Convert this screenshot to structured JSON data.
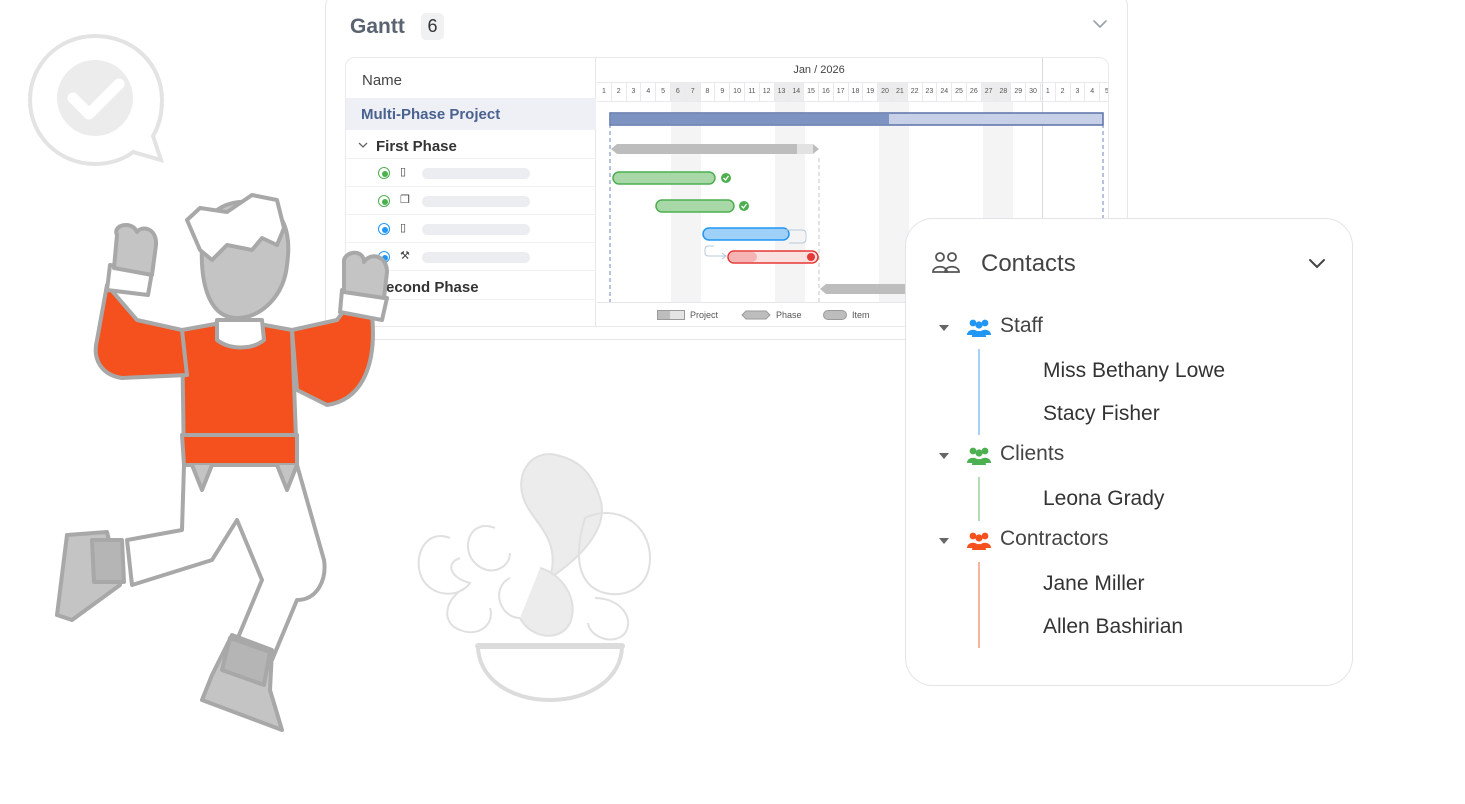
{
  "gantt": {
    "title": "Gantt",
    "count": "6",
    "name_header": "Name",
    "month": "Jan / 2026",
    "days": [
      "1",
      "2",
      "3",
      "4",
      "5",
      "6",
      "7",
      "8",
      "9",
      "10",
      "11",
      "12",
      "13",
      "14",
      "15",
      "16",
      "17",
      "18",
      "19",
      "20",
      "21",
      "22",
      "23",
      "24",
      "25",
      "26",
      "27",
      "28",
      "29",
      "30",
      "1",
      "2",
      "3",
      "4",
      "5"
    ],
    "rows": {
      "project": "Multi-Phase Project",
      "phase1": "First Phase",
      "phase2": "Second Phase"
    },
    "legend": [
      "Project",
      "Phase",
      "Item"
    ],
    "colors": {
      "project": "#6f86b8",
      "phase": "#b9b9b9",
      "done": "#4caf50",
      "active": "#2196f3",
      "late": "#e53935"
    }
  },
  "contacts": {
    "title": "Contacts",
    "groups": [
      {
        "label": "Staff",
        "color": "#2196f3",
        "members": [
          "Miss Bethany Lowe",
          "Stacy Fisher"
        ]
      },
      {
        "label": "Clients",
        "color": "#4caf50",
        "members": [
          "Leona Grady"
        ]
      },
      {
        "label": "Contractors",
        "color": "#f4511e",
        "members": [
          "Jane Miller",
          "Allen Bashirian"
        ]
      }
    ]
  },
  "illustration": {
    "shirt_color": "#f4511e",
    "outline_color": "#a8a8a8"
  }
}
